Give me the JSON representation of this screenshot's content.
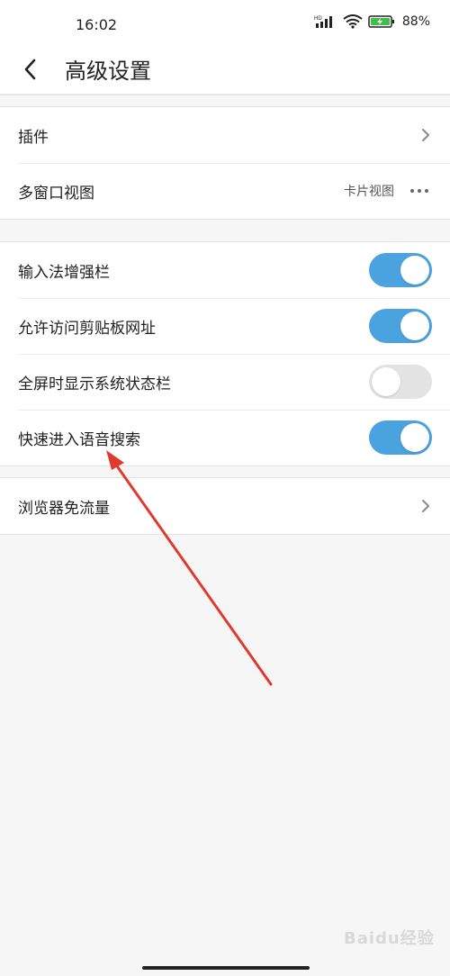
{
  "statusbar": {
    "time": "16:02",
    "network_label": "HD",
    "battery_percent": "88%"
  },
  "header": {
    "title": "高级设置"
  },
  "groups": {
    "one": {
      "plugins_label": "插件",
      "multiwindow_label": "多窗口视图",
      "multiwindow_value": "卡片视图"
    },
    "two": {
      "items": [
        {
          "label": "输入法增强栏",
          "on": true
        },
        {
          "label": "允许访问剪贴板网址",
          "on": true
        },
        {
          "label": "全屏时显示系统状态栏",
          "on": false
        },
        {
          "label": "快速进入语音搜索",
          "on": true
        }
      ]
    },
    "three": {
      "free_data_label": "浏览器免流量"
    }
  },
  "watermark": "Baidu经验",
  "colors": {
    "toggle_on": "#4aa3df",
    "toggle_off": "#e3e3e3",
    "annotation_arrow": "#e03a2f"
  }
}
